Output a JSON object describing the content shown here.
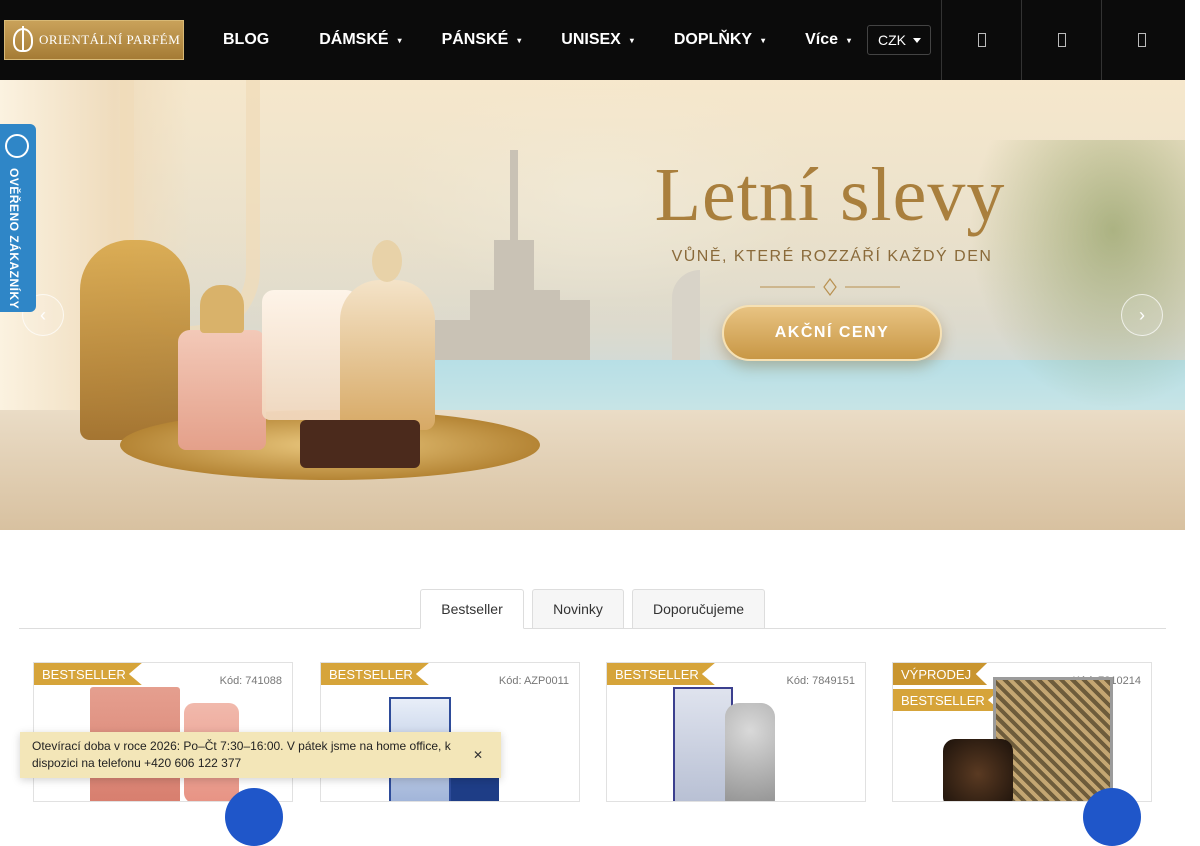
{
  "header": {
    "logo_text": "ORIENTÁLNÍ PARFÉM",
    "nav": [
      {
        "label": "BLOG"
      },
      {
        "label": "DÁMSKÉ"
      },
      {
        "label": "PÁNSKÉ"
      },
      {
        "label": "UNISEX"
      },
      {
        "label": "DOPLŇKY"
      },
      {
        "label": "Více"
      }
    ],
    "currency": "CZK",
    "icons": [
      "search-icon",
      "user-icon",
      "cart-icon"
    ]
  },
  "verified_badge": {
    "label": "OVĚŘENO ZÁKAZNÍKY"
  },
  "banner": {
    "title": "Letní slevy",
    "subtitle": "VŮNĚ, KTERÉ ROZZÁŘÍ KAŽDÝ DEN",
    "cta": "AKČNÍ CENY"
  },
  "tabs": [
    {
      "label": "Bestseller",
      "active": true
    },
    {
      "label": "Novinky",
      "active": false
    },
    {
      "label": "Doporučujeme",
      "active": false
    }
  ],
  "products": [
    {
      "badges": [
        "BESTSELLER"
      ],
      "code": "Kód: 741088"
    },
    {
      "badges": [
        "BESTSELLER"
      ],
      "code": "Kód: AZP0011"
    },
    {
      "badges": [
        "BESTSELLER"
      ],
      "code": "Kód: 7849151"
    },
    {
      "badges": [
        "VÝPRODEJ",
        "BESTSELLER"
      ],
      "code": "Kód: 7810214"
    }
  ],
  "notice": {
    "text": "Otevírací doba v roce 2026: Po–Čt 7:30–16:00. V pátek jsme na home office, k dispozici na telefonu",
    "phone": "+420 606 122 377"
  },
  "colors": {
    "header_bg": "#0b0b0b",
    "accent_gold": "#d6a43a",
    "badge_blue": "#2f86c7",
    "notice_bg": "#f3e6b8"
  }
}
